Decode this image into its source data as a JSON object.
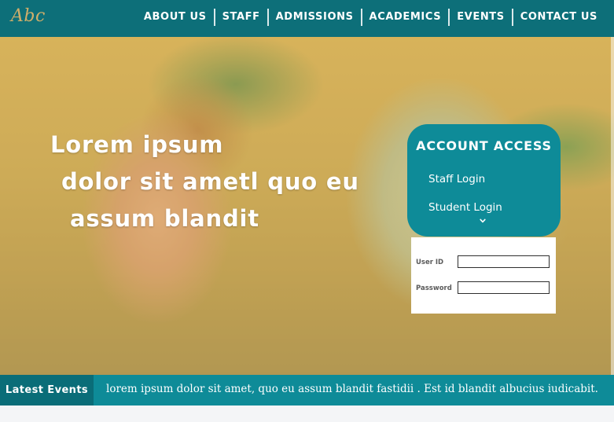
{
  "header": {
    "logo": "Abc",
    "nav": [
      "ABOUT US",
      "STAFF",
      "ADMISSIONS",
      "ACADEMICS",
      "EVENTS",
      "CONTACT US"
    ]
  },
  "hero": {
    "heading_lines": [
      "Lorem ipsum",
      "dolor sit ametl quo eu",
      "assum blandit"
    ]
  },
  "account": {
    "title": "ACCOUNT ACCESS",
    "staff_login": "Staff  Login",
    "student_login": "Student  Login",
    "chevron_icon": "chevron-down-icon"
  },
  "login": {
    "user_label": "User ID",
    "password_label": "Password",
    "user_value": "",
    "password_value": ""
  },
  "events": {
    "label": "Latest  Events",
    "text": "lorem ipsum dolor sit amet, quo eu assum blandit fastidii . Est id blandit albucius iudicabit."
  },
  "colors": {
    "header": "#0d6f79",
    "accent": "#0e8b98",
    "events_label_bg": "#0a6d78",
    "logo": "#cfae6a",
    "hero_tint": "#eec85c"
  }
}
